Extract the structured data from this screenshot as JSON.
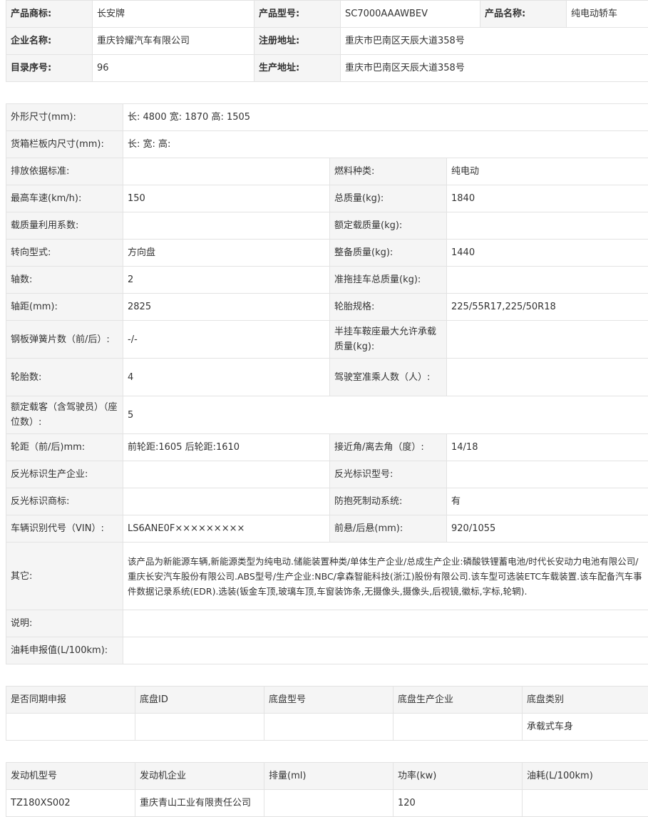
{
  "product": {
    "brand_label": "产品商标:",
    "brand": "长安牌",
    "model_label": "产品型号:",
    "model": "SC7000AAAWBEV",
    "name_label": "产品名称:",
    "name": "纯电动轿车",
    "company_label": "企业名称:",
    "company": "重庆铃耀汽车有限公司",
    "reg_addr_label": "注册地址:",
    "reg_addr": "重庆市巴南区天辰大道358号",
    "catalog_label": "目录序号:",
    "catalog": "96",
    "prod_addr_label": "生产地址:",
    "prod_addr": "重庆市巴南区天辰大道358号"
  },
  "specs": {
    "dims_label": "外形尺寸(mm):",
    "dims": "长: 4800 宽: 1870 高: 1505",
    "cargo_dims_label": "货箱栏板内尺寸(mm):",
    "cargo_dims": "长:  宽:  高:",
    "emission_label": "排放依据标准:",
    "emission": "",
    "fuel_label": "燃料种类:",
    "fuel": "纯电动",
    "speed_label": "最高车速(km/h):",
    "speed": "150",
    "total_mass_label": "总质量(kg):",
    "total_mass": "1840",
    "load_coef_label": "载质量利用系数:",
    "load_coef": "",
    "rated_load_label": "额定载质量(kg):",
    "rated_load": "",
    "steering_label": "转向型式:",
    "steering": "方向盘",
    "curb_mass_label": "整备质量(kg):",
    "curb_mass": "1440",
    "axles_label": "轴数:",
    "axles": "2",
    "trailer_label": "准拖挂车总质量(kg):",
    "trailer": "",
    "wheelbase_label": "轴距(mm):",
    "wheelbase": "2825",
    "tire_spec_label": "轮胎规格:",
    "tire_spec": "225/55R17,225/50R18",
    "leaf_label": "钢板弹簧片数（前/后）:",
    "leaf": "-/-",
    "saddle_label": "半挂车鞍座最大允许承载质量(kg):",
    "saddle": "",
    "tires_label": "轮胎数:",
    "tires": "4",
    "cab_label": "驾驶室准乘人数（人）:",
    "cab": "",
    "seats_label": "额定载客（含驾驶员）（座位数）:",
    "seats": "5",
    "track_label": "轮距（前/后)mm:",
    "track": "前轮距:1605 后轮距:1610",
    "angle_label": "接近角/离去角（度）:",
    "angle": "14/18",
    "refl_maker_label": "反光标识生产企业:",
    "refl_maker": "",
    "refl_model_label": "反光标识型号:",
    "refl_model": "",
    "refl_brand_label": "反光标识商标:",
    "refl_brand": "",
    "abs_label": "防抱死制动系统:",
    "abs": "有",
    "vin_label": "车辆识别代号（VIN）:",
    "vin": "LS6ANE0F×××××××××",
    "overhang_label": "前悬/后悬(mm):",
    "overhang": "920/1055",
    "other_label": "其它:",
    "other": "该产品为新能源车辆,新能源类型为纯电动.储能装置种类/单体生产企业/总成生产企业:磷酸铁锂蓄电池/时代长安动力电池有限公司/重庆长安汽车股份有限公司.ABS型号/生产企业:NBC/拿森智能科技(浙江)股份有限公司.该车型可选装ETC车载装置.该车配备汽车事件数据记录系统(EDR).选装(钣金车顶,玻璃车顶,车窗装饰条,无摄像头,摄像头,后视镜,徽标,字标,轮辋).",
    "note_label": "说明:",
    "note": "",
    "fuel_report_label": "油耗申报值(L/100km):",
    "fuel_report": ""
  },
  "chassis": {
    "headers": [
      "是否同期申报",
      "底盘ID",
      "底盘型号",
      "底盘生产企业",
      "底盘类别"
    ],
    "row": [
      "",
      "",
      "",
      "",
      "承载式车身"
    ]
  },
  "engine": {
    "headers": [
      "发动机型号",
      "发动机企业",
      "排量(ml)",
      "功率(kw)",
      "油耗(L/100km)"
    ],
    "row": [
      "TZ180XS002",
      "重庆青山工业有限责任公司",
      "",
      "120",
      ""
    ]
  }
}
